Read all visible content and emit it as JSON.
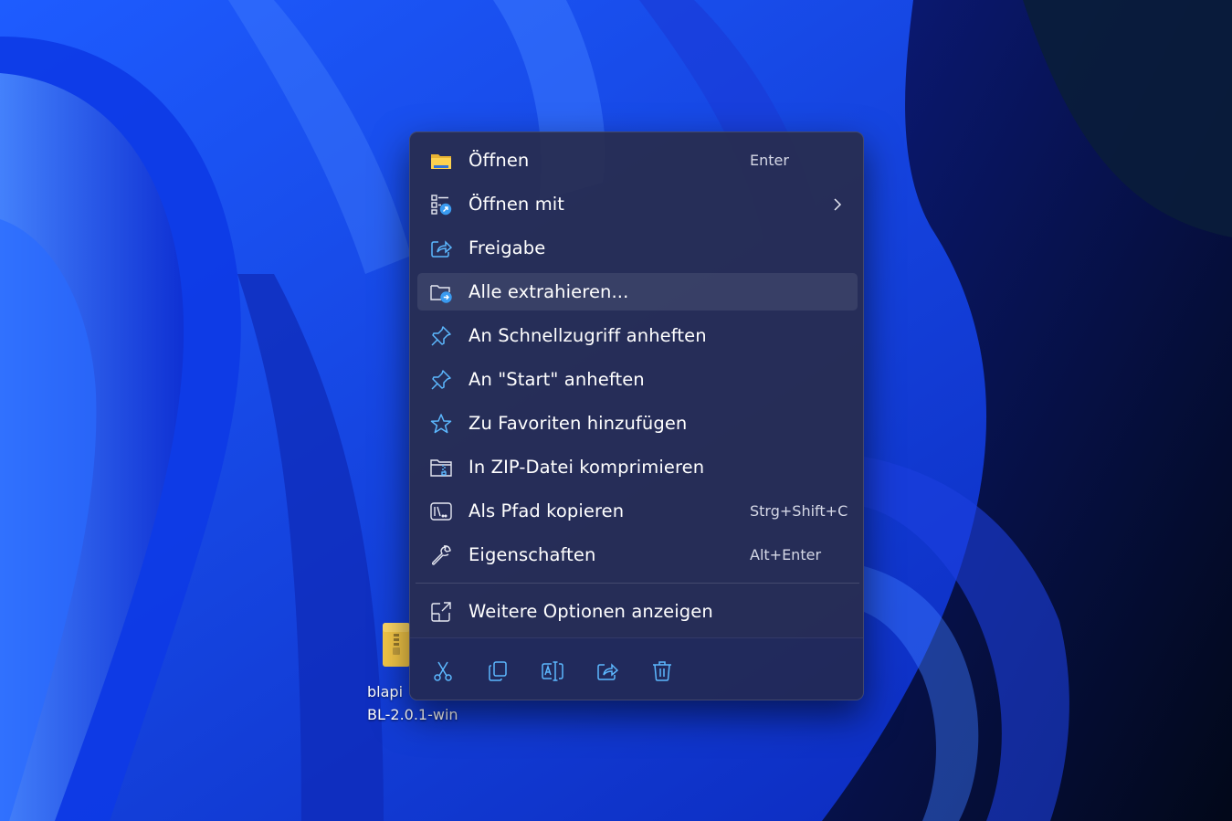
{
  "desktop": {
    "file_icon": "zip-folder-icon",
    "file_name_line1": "blapi ",
    "file_name_line2": "BL-2.0.1-win"
  },
  "context_menu": {
    "items": [
      {
        "label": "Öffnen",
        "shortcut": "Enter",
        "icon": "folder-icon"
      },
      {
        "label": "Öffnen mit",
        "shortcut": "",
        "icon": "open-with-icon",
        "submenu": true
      },
      {
        "label": "Freigabe",
        "shortcut": "",
        "icon": "share-icon"
      },
      {
        "label": "Alle extrahieren...",
        "shortcut": "",
        "icon": "extract-icon",
        "highlighted": true
      },
      {
        "label": "An Schnellzugriff anheften",
        "shortcut": "",
        "icon": "pin-icon"
      },
      {
        "label": "An \"Start\" anheften",
        "shortcut": "",
        "icon": "pin-icon"
      },
      {
        "label": "Zu Favoriten hinzufügen",
        "shortcut": "",
        "icon": "star-icon"
      },
      {
        "label": "In ZIP-Datei komprimieren",
        "shortcut": "",
        "icon": "zip-compress-icon"
      },
      {
        "label": "Als Pfad kopieren",
        "shortcut": "Strg+Shift+C",
        "icon": "copy-path-icon"
      },
      {
        "label": "Eigenschaften",
        "shortcut": "Alt+Enter",
        "icon": "wrench-icon"
      },
      {
        "label": "Weitere Optionen anzeigen",
        "shortcut": "",
        "icon": "more-options-icon"
      }
    ],
    "toolbar": [
      "cut-icon",
      "copy-icon",
      "rename-icon",
      "share-icon",
      "delete-icon"
    ]
  },
  "colors": {
    "menu_bg": "#2a2d4f",
    "accent_icon": "#5cb8ff",
    "folder_yellow": "#f7c948"
  }
}
